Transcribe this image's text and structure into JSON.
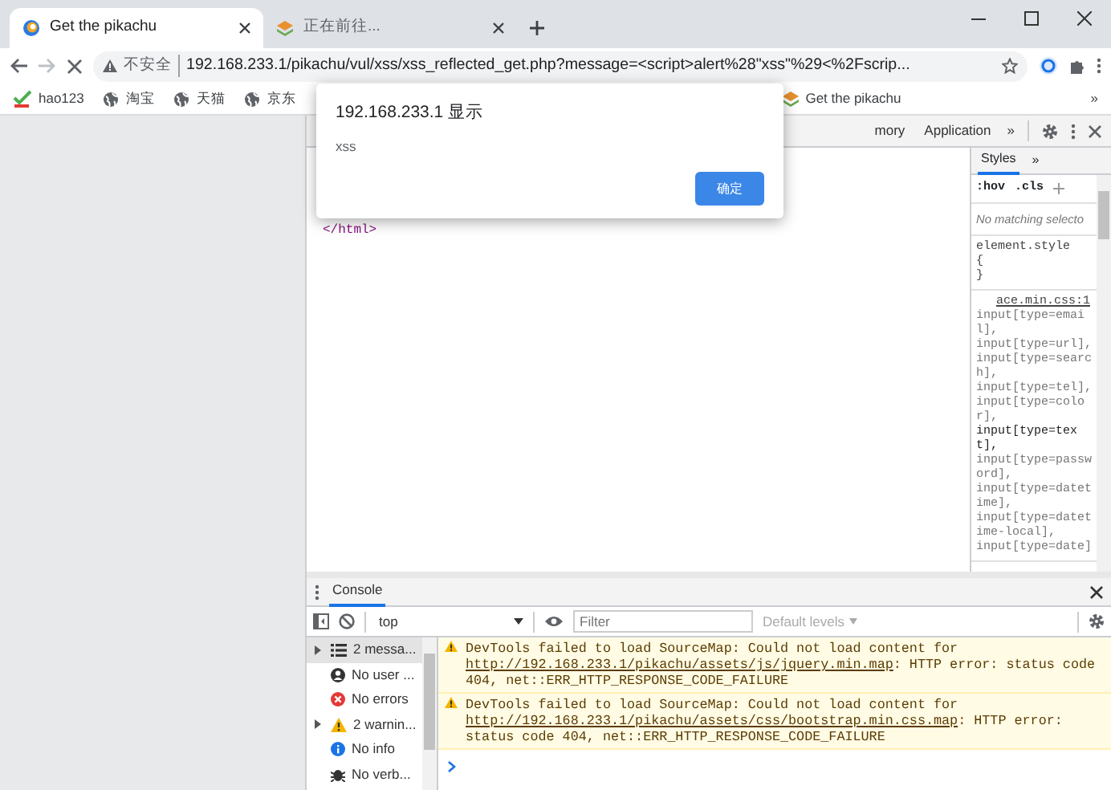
{
  "browser": {
    "tabs": [
      {
        "title": "Get the pikachu",
        "kind": "swirl",
        "selected": true
      },
      {
        "title": "正在前往...",
        "kind": "stack",
        "selected": false
      }
    ],
    "address": {
      "security": "不安全",
      "url": "192.168.233.1/pikachu/vul/xss/xss_reflected_get.php?message=<script>alert%28\"xss\"%29<%2Fscrip..."
    },
    "bookmarks": [
      {
        "label": "hao123",
        "kind": "hao"
      },
      {
        "label": "淘宝",
        "kind": "globe"
      },
      {
        "label": "天猫",
        "kind": "globe"
      },
      {
        "label": "京东",
        "kind": "globe"
      },
      {
        "label": "Get the pikachu",
        "kind": "stack"
      }
    ],
    "bookmarks_more": "»"
  },
  "devtools": {
    "tabs": [
      {
        "label": "mory",
        "selected": false
      },
      {
        "label": "Application",
        "selected": false
      }
    ],
    "tabs_more": "»",
    "elements": [
      "</html>"
    ],
    "styles": {
      "tabs": [
        {
          "label": "Styles",
          "selected": true
        }
      ],
      "tabs_more": "»",
      "filters": [
        ":hov",
        ".cls"
      ],
      "no_match": "No matching selecto",
      "element_style": [
        "element.style",
        "{",
        "}"
      ],
      "rule_source": "ace.min.css:1",
      "selectors": [
        {
          "text": "input[type=email],",
          "matched": false
        },
        {
          "text": "input[type=url],",
          "matched": false
        },
        {
          "text": "input[type=search],",
          "matched": false
        },
        {
          "text": "input[type=tel],",
          "matched": false
        },
        {
          "text": "input[type=color],",
          "matched": false
        },
        {
          "text": "input[type=text],",
          "matched": true
        },
        {
          "text": "input[type=password],",
          "matched": false
        },
        {
          "text": "input[type=datetime],",
          "matched": false
        },
        {
          "text": "input[type=datetime-local],",
          "matched": false
        },
        {
          "text": "input[type=date]",
          "matched": false
        }
      ]
    }
  },
  "console": {
    "tabs": [
      {
        "label": "Console",
        "selected": true
      }
    ],
    "context": "top",
    "filter": {
      "placeholder": "Filter"
    },
    "levels": "Default levels",
    "sidebar": [
      {
        "label": "2 messa...",
        "kind": "list",
        "expandable": true,
        "selected": true
      },
      {
        "label": "No user ...",
        "kind": "user",
        "expandable": false,
        "selected": false
      },
      {
        "label": "No errors",
        "kind": "error",
        "expandable": false,
        "selected": false
      },
      {
        "label": "2 warnin...",
        "kind": "warning",
        "expandable": true,
        "selected": false
      },
      {
        "label": "No info",
        "kind": "info",
        "expandable": false,
        "selected": false
      },
      {
        "label": "No verb...",
        "kind": "verbose",
        "expandable": false,
        "selected": false
      }
    ],
    "messages": [
      {
        "kind": "warning",
        "text": "DevTools failed to load SourceMap: Could not load content for ",
        "link": "http://192.168.233.1/pikachu/assets/js/jquery.min.map",
        "after": ": HTTP error: status code 404, net::ERR_HTTP_RESPONSE_CODE_FAILURE"
      },
      {
        "kind": "warning",
        "text": "DevTools failed to load SourceMap: Could not load content for ",
        "link": "http://192.168.233.1/pikachu/assets/css/bootstrap.min.css.map",
        "after": ": HTTP error: status code 404, net::ERR_HTTP_RESPONSE_CODE_FAILURE"
      }
    ]
  },
  "dialog": {
    "title": "192.168.233.1 显示",
    "message": "xss",
    "button": "确定"
  }
}
